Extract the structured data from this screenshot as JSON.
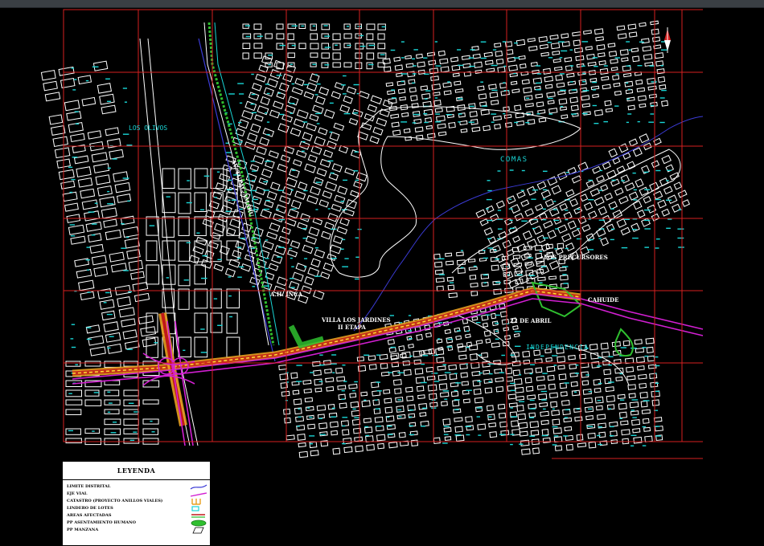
{
  "map": {
    "districts": [
      "LOS OLIVOS",
      "COMAS",
      "INDEPENDENCIA"
    ],
    "sectors": [
      "LOS PRECURSORES",
      "CAHUIDE",
      "22 DE ABRIL",
      "VILLA LOS JARDINES",
      "II ETAPA",
      "A.H. INCA"
    ],
    "road_name": "AV. TUPAC AMARU"
  },
  "legend": {
    "title": "LEYENDA",
    "items": [
      {
        "label": "LIMITE DISTRITAL",
        "symbol": "blue-line",
        "color": "#3b3bd6"
      },
      {
        "label": "EJE VIAL",
        "symbol": "magenta-line",
        "color": "#d21fd2"
      },
      {
        "label": "CATASTRO (PROYECTO ANILLOS VIALES)",
        "symbol": "orange-lots",
        "color": "#e8a020"
      },
      {
        "label": "LINDERO DE LOTES",
        "symbol": "cyan-box",
        "color": "#19d6d6"
      },
      {
        "label": "AREAS AFECTADAS",
        "symbol": "red-green-lines",
        "color": "#c01818"
      },
      {
        "label": "PP ASENTAMIENTO HUMANO",
        "symbol": "green-blob",
        "color": "#2fbf2f"
      },
      {
        "label": "PP MANZANA",
        "symbol": "white-parallelogram",
        "color": "#ffffff"
      }
    ]
  }
}
